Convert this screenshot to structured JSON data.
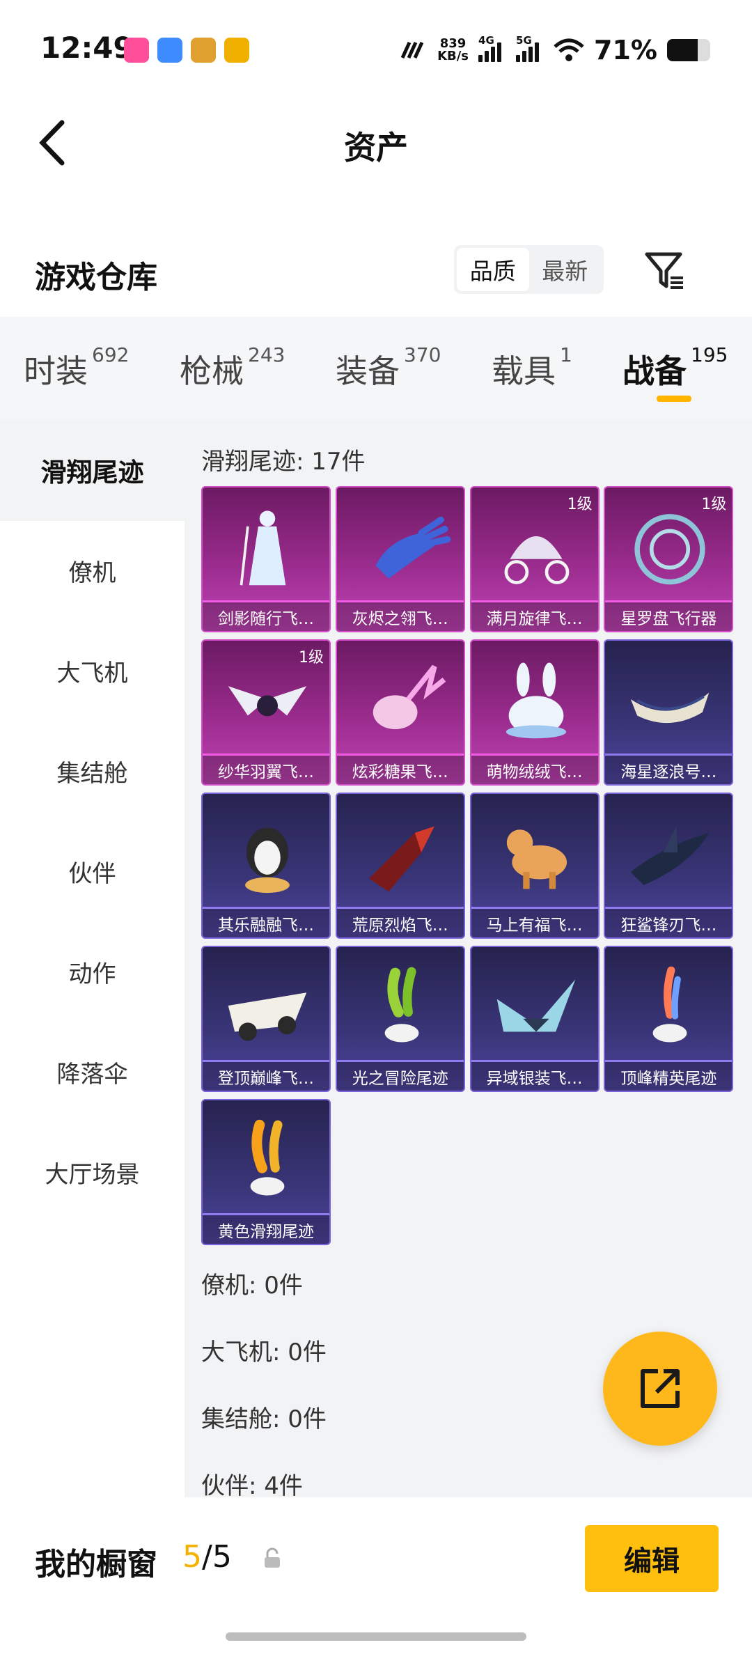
{
  "status_bar": {
    "time": "12:49",
    "speed_value": "839",
    "speed_unit": "KB/s",
    "net1": "4G",
    "net2": "5G",
    "battery_text": "71%",
    "battery_level": 0.71,
    "app_icons": [
      "bilibili-icon",
      "game-app-icon-1",
      "game-app-icon-2",
      "game-app-icon-3"
    ],
    "app_colors": [
      "#ff4f9a",
      "#3f8cff",
      "#e0a030",
      "#f0b000"
    ]
  },
  "header": {
    "title": "资产",
    "back_icon": "back-arrow-icon"
  },
  "warehouse": {
    "title": "游戏仓库",
    "sort_options": [
      "品质",
      "最新"
    ],
    "active_sort": "品质",
    "filter_icon": "filter-icon"
  },
  "tabs": [
    {
      "label": "时装",
      "count": "692"
    },
    {
      "label": "枪械",
      "count": "243"
    },
    {
      "label": "装备",
      "count": "370"
    },
    {
      "label": "载具",
      "count": "1"
    },
    {
      "label": "战备",
      "count": "195"
    }
  ],
  "active_tab": "战备",
  "accent_color": "#ffb400",
  "sidebar": {
    "items": [
      "滑翔尾迹",
      "僚机",
      "大飞机",
      "集结舱",
      "伙伴",
      "动作",
      "降落伞",
      "大厅场景"
    ],
    "active": "滑翔尾迹"
  },
  "sections": [
    {
      "header": "滑翔尾迹: 17件"
    },
    {
      "header": "僚机: 0件"
    },
    {
      "header": "大飞机: 0件"
    },
    {
      "header": "集结舱: 0件"
    },
    {
      "header": "伙伴: 4件"
    }
  ],
  "items": [
    {
      "name": "剑影随行飞…",
      "rarity": "pink",
      "level": "",
      "icon": "swordsman-figure-icon"
    },
    {
      "name": "灰烬之翎飞…",
      "rarity": "pink",
      "level": "",
      "icon": "glowing-hand-icon"
    },
    {
      "name": "满月旋律飞…",
      "rarity": "pink",
      "level": "1级",
      "icon": "carriage-icon"
    },
    {
      "name": "星罗盘飞行器",
      "rarity": "pink",
      "level": "1级",
      "icon": "astrolabe-icon"
    },
    {
      "name": "纱华羽翼飞…",
      "rarity": "pink",
      "level": "1级",
      "icon": "winged-craft-icon"
    },
    {
      "name": "炫彩糖果飞…",
      "rarity": "pink",
      "level": "",
      "icon": "candy-icon"
    },
    {
      "name": "萌物绒绒飞…",
      "rarity": "pink",
      "level": "",
      "icon": "plush-bunny-icon"
    },
    {
      "name": "海星逐浪号…",
      "rarity": "blue",
      "level": "",
      "icon": "boat-icon"
    },
    {
      "name": "其乐融融飞…",
      "rarity": "blue",
      "level": "",
      "icon": "penguin-icon"
    },
    {
      "name": "荒原烈焰飞…",
      "rarity": "blue",
      "level": "",
      "icon": "flame-craft-icon"
    },
    {
      "name": "马上有福飞…",
      "rarity": "blue",
      "level": "",
      "icon": "horse-toy-icon"
    },
    {
      "name": "狂鲨锋刃飞…",
      "rarity": "blue",
      "level": "",
      "icon": "shark-craft-icon"
    },
    {
      "name": "登顶巅峰飞…",
      "rarity": "blue",
      "level": "",
      "icon": "jet-craft-icon"
    },
    {
      "name": "光之冒险尾迹",
      "rarity": "blue",
      "level": "",
      "icon": "green-trail-icon"
    },
    {
      "name": "异域银装飞…",
      "rarity": "blue",
      "level": "",
      "icon": "silver-wing-icon"
    },
    {
      "name": "顶峰精英尾迹",
      "rarity": "blue",
      "level": "",
      "icon": "blue-trail-icon"
    },
    {
      "name": "黄色滑翔尾迹",
      "rarity": "blue",
      "level": "",
      "icon": "yellow-trail-icon"
    }
  ],
  "share_icon": "share-external-icon",
  "bottom_bar": {
    "showcase_label": "我的橱窗",
    "showcase_current": "5",
    "showcase_total": "/5",
    "lock_icon": "unlock-icon",
    "edit_label": "编辑"
  }
}
